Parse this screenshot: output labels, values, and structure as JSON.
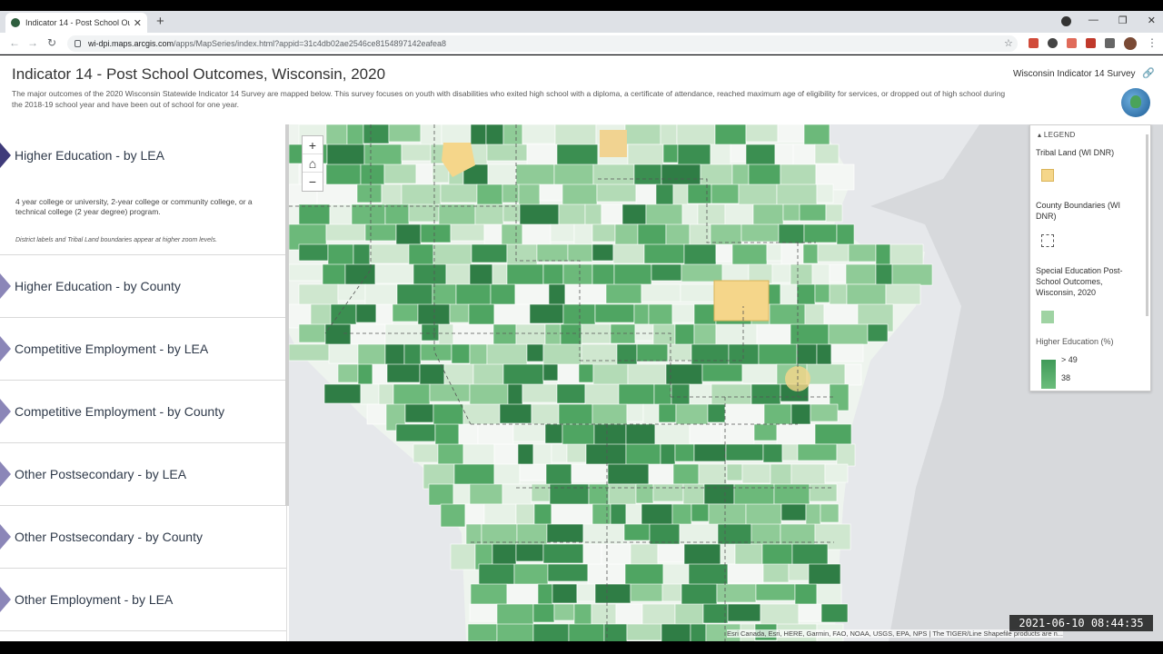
{
  "browser": {
    "tab_title": "Indicator 14 - Post School Outco",
    "url_host": "wi-dpi.maps.arcgis.com",
    "url_path": "/apps/MapSeries/index.html?appid=31c4db02ae2546ce8154897142eafea8"
  },
  "header": {
    "title": "Indicator 14 - Post School Outcomes, Wisconsin, 2020",
    "description": "The major outcomes of the 2020 Wisconsin Statewide Indicator 14 Survey are mapped below. This survey focuses on youth with disabilities who exited high school with a diploma, a certificate of attendance, reached maximum age of eligibility for services, or dropped out of high school during the 2018-19 school year and have been out of school for one year.",
    "series_link": "Wisconsin Indicator 14 Survey"
  },
  "sidebar": {
    "entries": [
      {
        "label": "Higher Education - by LEA",
        "body": "4 year college or university, 2-year college or community college, or a technical college (2 year degree) program.",
        "note": "District labels and Tribal Land boundaries appear at higher zoom levels."
      },
      {
        "label": "Higher Education - by County"
      },
      {
        "label": "Competitive Employment - by LEA"
      },
      {
        "label": "Competitive Employment - by County"
      },
      {
        "label": "Other Postsecondary - by LEA"
      },
      {
        "label": "Other Postsecondary - by County"
      },
      {
        "label": "Other Employment - by LEA"
      }
    ]
  },
  "map": {
    "zoom_in": "+",
    "zoom_out": "−",
    "attribution": "Esri Canada, Esri, HERE, Garmin, FAO, NOAA, USGS, EPA, NPS | The TIGER/Line Shapefile products are n..."
  },
  "legend": {
    "header": "LEGEND",
    "layers": [
      {
        "title": "Tribal Land (WI DNR)",
        "color": "#f5d68a"
      },
      {
        "title": "County Boundaries (WI DNR)",
        "color": "#ffffff"
      },
      {
        "title": "Special Education Post-School Outcomes, Wisconsin, 2020",
        "color": "#9fd3a3"
      }
    ],
    "field": "Higher Education (%)",
    "breaks": [
      "> 49",
      "38"
    ]
  },
  "timestamp": "2021-06-10  08:44:35"
}
